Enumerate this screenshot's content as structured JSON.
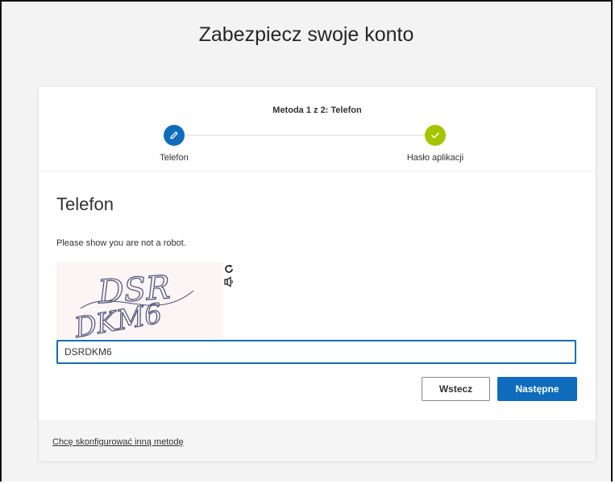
{
  "page": {
    "title": "Zabezpiecz swoje konto"
  },
  "progress": {
    "heading": "Metoda 1 z 2: Telefon",
    "steps": [
      {
        "label": "Telefon",
        "state": "current",
        "icon": "pencil-icon"
      },
      {
        "label": "Hasło aplikacji",
        "state": "done",
        "icon": "check-icon"
      }
    ]
  },
  "section": {
    "title": "Telefon",
    "robot_prompt": "Please show you are not a robot."
  },
  "captcha": {
    "image_text_line1": "DSR",
    "image_text_line2": "DKM6",
    "input_value": "DSRDKM6",
    "refresh_icon": "refresh-icon",
    "audio_icon": "audio-icon"
  },
  "buttons": {
    "back_label": "Wstecz",
    "next_label": "Następne"
  },
  "footer": {
    "alt_method_link": "Chcę skonfigurować inną metodę"
  },
  "colors": {
    "accent": "#0f6cbd",
    "done": "#a4c400"
  }
}
